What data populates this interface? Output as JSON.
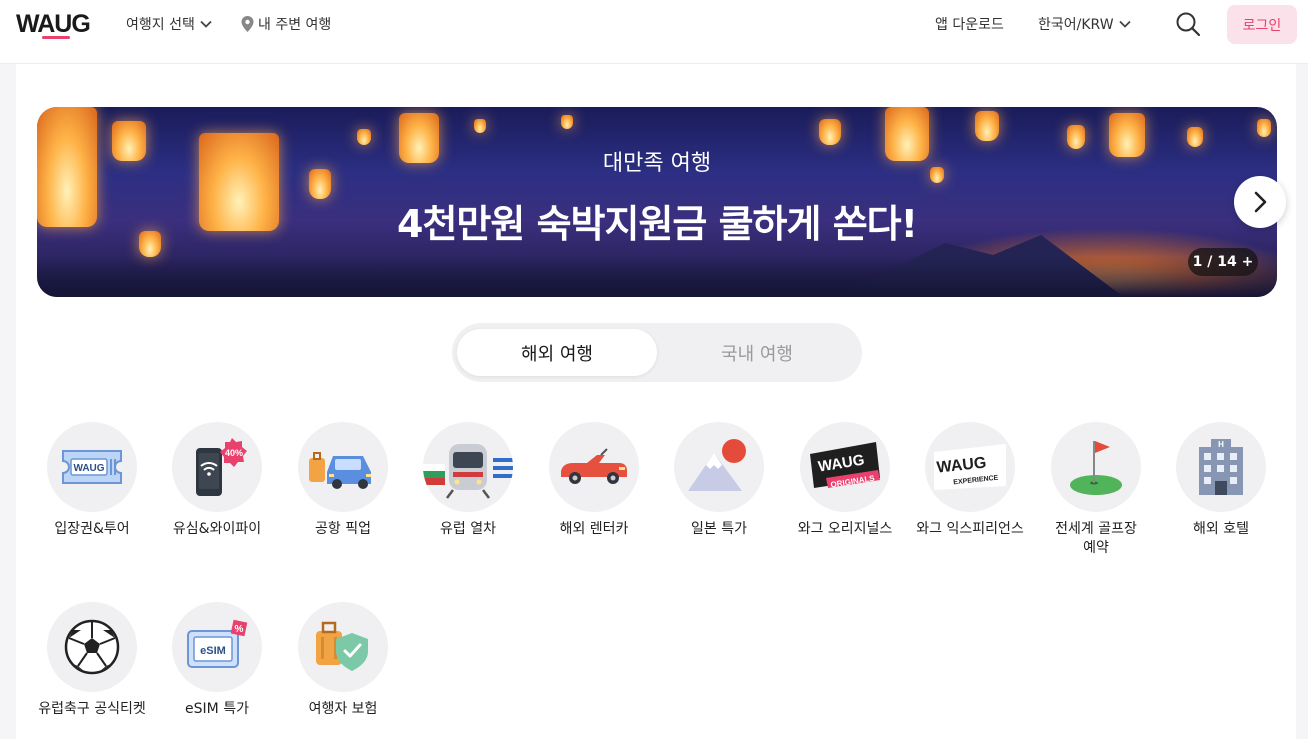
{
  "header": {
    "logo": "WAUG",
    "destination_select": "여행지 선택",
    "nearby": "내 주변 여행",
    "app_download": "앱 다운로드",
    "lang_currency": "한국어/KRW",
    "login": "로그인"
  },
  "banner": {
    "subtitle": "대만족 여행",
    "title": "4천만원 숙박지원금 쿨하게 쏜다!",
    "counter": "1 / 14 +"
  },
  "tabs": {
    "overseas": "해외 여행",
    "domestic": "국내 여행"
  },
  "categories": [
    {
      "label": "입장권&투어",
      "icon": "ticket-icon"
    },
    {
      "label": "유심&와이파이",
      "icon": "phone-wifi-icon",
      "badge": "40%"
    },
    {
      "label": "공항 픽업",
      "icon": "car-luggage-icon"
    },
    {
      "label": "유럽 열차",
      "icon": "train-icon"
    },
    {
      "label": "해외 렌터카",
      "icon": "convertible-car-icon"
    },
    {
      "label": "일본 특가",
      "icon": "mount-fuji-icon"
    },
    {
      "label": "와그 오리지널스",
      "icon": "waug-originals-icon",
      "icon_text": "WAUG",
      "icon_sub": "ORIGINALS"
    },
    {
      "label": "와그 익스피리언스",
      "icon": "waug-experience-icon",
      "icon_text": "WAUG",
      "icon_sub": "EXPERIENCE"
    },
    {
      "label": "전세계 골프장\n예약",
      "label1": "전세계 골프장",
      "label2": "예약",
      "icon": "golf-flag-icon"
    },
    {
      "label": "해외 호텔",
      "icon": "hotel-building-icon"
    },
    {
      "label": "유럽축구 공식티켓",
      "icon": "soccer-ball-icon"
    },
    {
      "label": "eSIM 특가",
      "icon": "esim-card-icon",
      "icon_text": "eSIM"
    },
    {
      "label": "여행자 보험",
      "icon": "insurance-shield-icon"
    }
  ],
  "colors": {
    "accent": "#e8416e",
    "login_bg": "#fbe1ea"
  }
}
